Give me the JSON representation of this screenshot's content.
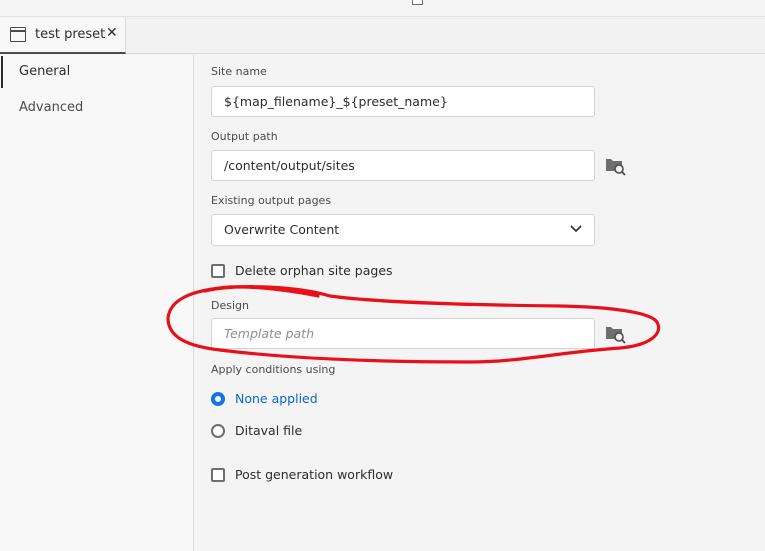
{
  "tab": {
    "label": "test preset",
    "close": "✕"
  },
  "sidebar": {
    "items": [
      {
        "label": "General"
      },
      {
        "label": "Advanced"
      }
    ]
  },
  "form": {
    "site_name": {
      "label": "Site name",
      "value": "${map_filename}_${preset_name}"
    },
    "output_path": {
      "label": "Output path",
      "value": "/content/output/sites"
    },
    "existing_pages": {
      "label": "Existing output pages",
      "value": "Overwrite Content"
    },
    "delete_orphan": {
      "label": "Delete orphan site pages",
      "checked": false
    },
    "design": {
      "label": "Design",
      "placeholder": "Template path"
    },
    "apply_conditions": {
      "label": "Apply conditions using",
      "options": [
        {
          "label": "None applied",
          "selected": true
        },
        {
          "label": "Ditaval file",
          "selected": false
        }
      ]
    },
    "post_generation": {
      "label": "Post generation workflow",
      "checked": false
    }
  },
  "colors": {
    "accent": "#1473e6",
    "annotation": "#e8101a"
  },
  "icons": {
    "picker": "folder-search-icon",
    "dropdown": "chevron-down-icon",
    "tab": "window-icon"
  }
}
